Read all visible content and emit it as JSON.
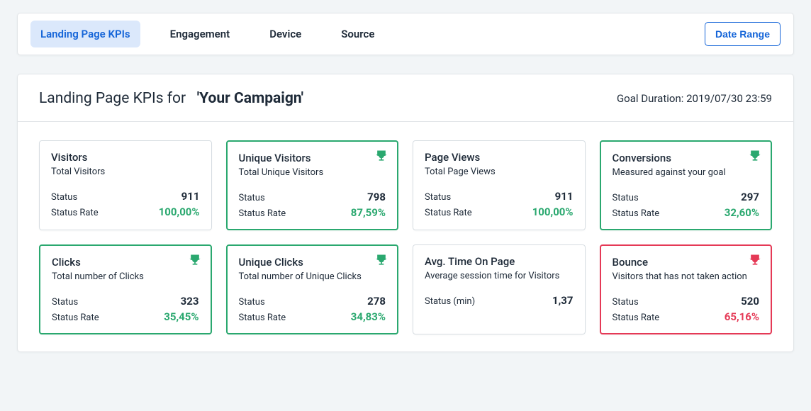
{
  "tabs": {
    "items": [
      "Landing Page KPIs",
      "Engagement",
      "Device",
      "Source"
    ],
    "dateRangeLabel": "Date Range"
  },
  "header": {
    "titlePrefix": "Landing Page KPIs for",
    "campaignName": "'Your Campaign'",
    "goalDurationLabel": "Goal Duration:",
    "goalDurationValue": "2019/07/30 23:59"
  },
  "labels": {
    "status": "Status",
    "statusRate": "Status Rate",
    "statusMin": "Status (min)"
  },
  "cards": [
    {
      "title": "Visitors",
      "subtitle": "Total Visitors",
      "value": "911",
      "rate": "100,00%",
      "rateClass": "rate-green",
      "border": "plain",
      "trophy": null
    },
    {
      "title": "Unique Visitors",
      "subtitle": "Total Unique Visitors",
      "value": "798",
      "rate": "87,59%",
      "rateClass": "rate-green",
      "border": "green",
      "trophy": "green"
    },
    {
      "title": "Page Views",
      "subtitle": "Total Page Views",
      "value": "911",
      "rate": "100,00%",
      "rateClass": "rate-green",
      "border": "plain",
      "trophy": null
    },
    {
      "title": "Conversions",
      "subtitle": "Measured against your goal",
      "value": "297",
      "rate": "32,60%",
      "rateClass": "rate-green",
      "border": "green",
      "trophy": "green"
    },
    {
      "title": "Clicks",
      "subtitle": "Total number of Clicks",
      "value": "323",
      "rate": "35,45%",
      "rateClass": "rate-green",
      "border": "green",
      "trophy": "green"
    },
    {
      "title": "Unique Clicks",
      "subtitle": "Total number of Unique Clicks",
      "value": "278",
      "rate": "34,83%",
      "rateClass": "rate-green",
      "border": "green",
      "trophy": "green"
    },
    {
      "title": "Avg. Time On Page",
      "subtitle": "Average session time for Visitors",
      "singleLabel": "Status (min)",
      "singleValue": "1,37",
      "border": "plain",
      "trophy": null
    },
    {
      "title": "Bounce",
      "subtitle": "Visitors that has not taken action",
      "value": "520",
      "rate": "65,16%",
      "rateClass": "rate-red",
      "border": "red",
      "trophy": "red"
    }
  ]
}
